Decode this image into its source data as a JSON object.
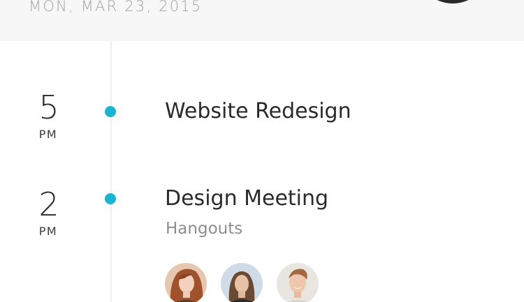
{
  "header": {
    "date": "MON, MAR 23, 2015"
  },
  "colors": {
    "accent": "#19b5d0",
    "header_bg": "#f7f7f7",
    "fab": "#2a2a2a"
  },
  "events": [
    {
      "hour": "5",
      "meridiem": "PM",
      "title": "Website Redesign",
      "subtitle": ""
    },
    {
      "hour": "2",
      "meridiem": "PM",
      "title": "Design Meeting",
      "subtitle": "Hangouts",
      "attendees": [
        "attendee-avatar-1",
        "attendee-avatar-2",
        "attendee-avatar-3"
      ]
    }
  ]
}
